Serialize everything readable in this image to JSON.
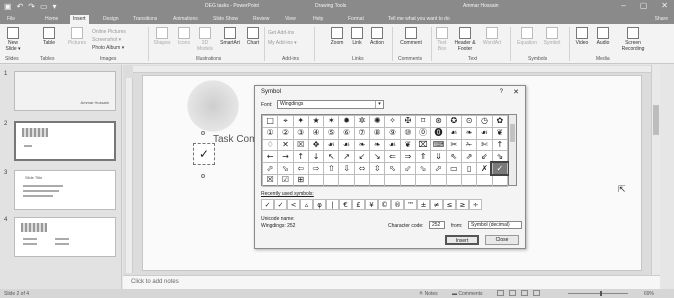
{
  "titlebar": {
    "qat_icons": [
      "save-icon",
      "undo-icon",
      "redo-icon",
      "present-icon",
      "customize-icon"
    ],
    "qat_glyphs": [
      "▣",
      "↶",
      "↷",
      "▭",
      "▾"
    ],
    "doc_title": "DEG tasks - PowerPoint",
    "context_title": "Drawing Tools",
    "user_name": "Ammar Hossain",
    "window_controls": [
      "–",
      "▢",
      "✕"
    ]
  },
  "tabs": {
    "items": [
      "File",
      "Home",
      "Insert",
      "Design",
      "Transitions",
      "Animations",
      "Slide Show",
      "Review",
      "View",
      "Help",
      "Format"
    ],
    "active": "Insert",
    "tell_me": "Tell me what you want to do",
    "share": "Share"
  },
  "ribbon": {
    "buttons": [
      {
        "label": "New Slide ▾",
        "icon": "new-slide-icon"
      },
      {
        "label": "Table",
        "icon": "table-icon"
      },
      {
        "label": "Pictures",
        "icon": "pictures-icon"
      },
      {
        "label": "Shapes",
        "icon": "shapes-icon"
      },
      {
        "label": "Icons",
        "icon": "icons-icon"
      },
      {
        "label": "3D Models",
        "icon": "3d-models-icon"
      },
      {
        "label": "SmartArt",
        "icon": "smartart-icon"
      },
      {
        "label": "Chart",
        "icon": "chart-icon"
      },
      {
        "label": "Zoom",
        "icon": "zoom-icon"
      },
      {
        "label": "Link",
        "icon": "link-icon"
      },
      {
        "label": "Action",
        "icon": "action-icon"
      },
      {
        "label": "Comment",
        "icon": "comment-icon"
      },
      {
        "label": "Text Box",
        "icon": "text-box-icon"
      },
      {
        "label": "Header & Footer",
        "icon": "header-footer-icon"
      },
      {
        "label": "WordArt",
        "icon": "wordart-icon"
      },
      {
        "label": "Equation",
        "icon": "equation-icon"
      },
      {
        "label": "Symbol",
        "icon": "symbol-icon"
      },
      {
        "label": "Video",
        "icon": "video-icon"
      },
      {
        "label": "Audio",
        "icon": "audio-icon"
      },
      {
        "label": "Screen Recording",
        "icon": "screen-recording-icon"
      }
    ],
    "small_items": [
      "Online Pictures",
      "Screenshot ▾",
      "Photo Album ▾",
      "Get Add-ins",
      "My Add-ins ▾"
    ],
    "groups": [
      "Slides",
      "Tables",
      "Images",
      "Illustrations",
      "Add-ins",
      "Links",
      "Comments",
      "Text",
      "Symbols",
      "Media"
    ]
  },
  "thumbnails": [
    {
      "num": "1",
      "caption": "Ammar Hossain"
    },
    {
      "num": "2",
      "caption": ""
    },
    {
      "num": "3",
      "caption": "Slide Title"
    },
    {
      "num": "4",
      "caption": ""
    }
  ],
  "slide": {
    "task_text": "Task Com",
    "checkmark": "✓"
  },
  "notes_placeholder": "Click to add notes",
  "status": {
    "slide_info": "Slide 2 of 4",
    "notes": "≙ Notes",
    "comments": "▬ Comments",
    "zoom_pct": "69%"
  },
  "dialog": {
    "title": "Symbol",
    "help": "?",
    "close": "✕",
    "font_label": "Font:",
    "font_value": "Wingdings",
    "grid": [
      [
        "□",
        "⌖",
        "✦",
        "★",
        "✶",
        "✹",
        "✲",
        "✺",
        "✧",
        "✠",
        "⌑",
        "⊛",
        "✪",
        "⊙",
        "◷",
        "✿"
      ],
      [
        "①",
        "②",
        "③",
        "④",
        "⑤",
        "⑥",
        "⑦",
        "⑧",
        "⑨",
        "⑩",
        "⓪",
        "⓿",
        "☙",
        "❧",
        "☙",
        "❦"
      ],
      [
        "♢",
        "✕",
        "☒",
        "✥",
        "☙",
        "☙",
        "❧",
        "❧",
        "☙",
        "❦",
        "⌧",
        "⌨",
        "✂",
        "✁",
        "✄",
        "↑"
      ],
      [
        "←",
        "→",
        "↑",
        "↓",
        "↖",
        "↗",
        "↙",
        "↘",
        "⇐",
        "⇒",
        "⇑",
        "⇓",
        "⇖",
        "⇗",
        "⇙",
        "⇘"
      ],
      [
        "⬀",
        "⬂",
        "⇦",
        "⇨",
        "⇧",
        "⇩",
        "⬄",
        "⇳",
        "⬁",
        "⬃",
        "⬂",
        "⬀",
        "▭",
        "▯",
        "✗",
        "✓"
      ],
      [
        "☒",
        "☑",
        "⊞",
        "",
        "",
        "",
        "",
        "",
        "",
        "",
        "",
        "",
        "",
        "",
        "",
        ""
      ]
    ],
    "selected_row": 4,
    "selected_col": 15,
    "recent_label": "Recently used symbols:",
    "recent": [
      "✓",
      "✓",
      "<",
      "▵",
      "φ",
      "|",
      "€",
      "£",
      "¥",
      "©",
      "®",
      "™",
      "±",
      "≠",
      "≤",
      "≥",
      "÷"
    ],
    "unicode_name_label": "Unicode name:",
    "unicode_name": "Wingdings: 252",
    "char_code_label": "Character code:",
    "char_code": "252",
    "from_label": "from:",
    "from_value": "Symbol (decimal)",
    "insert_label": "Insert",
    "cancel_label": "Close"
  }
}
